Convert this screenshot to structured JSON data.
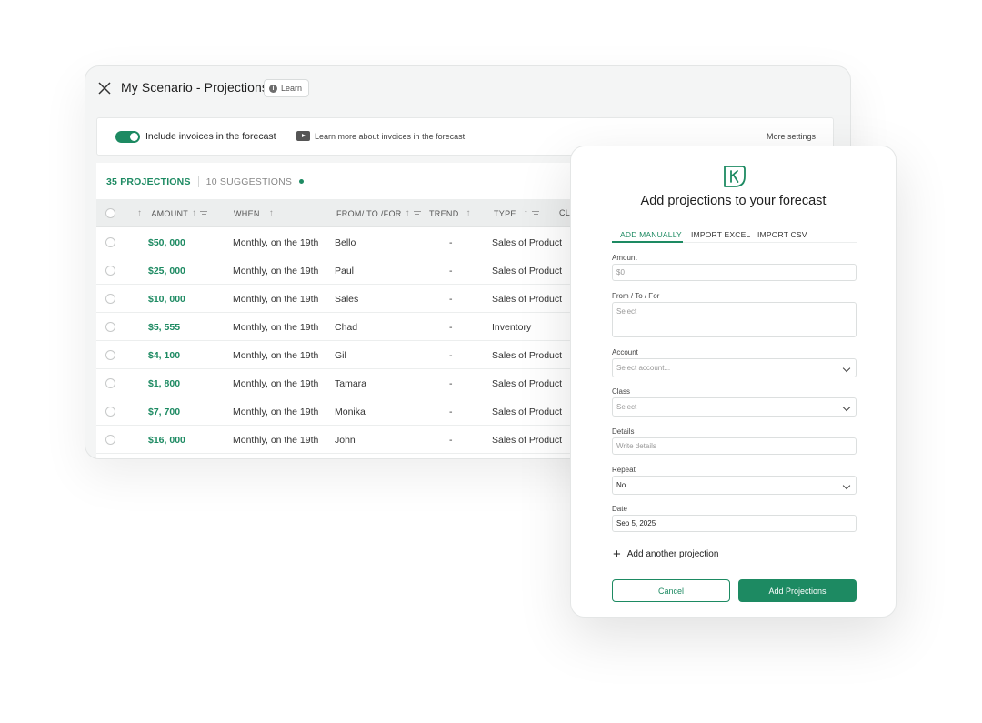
{
  "window": {
    "title": "My Scenario - Projections",
    "learn_label": "Learn"
  },
  "settings": {
    "toggle_label": "Include invoices in the forecast",
    "toggle_on": true,
    "video_link": "Learn more about invoices in the forecast",
    "more_settings": "More settings"
  },
  "tabs": {
    "projections": "35 PROJECTIONS",
    "suggestions": "10 SUGGESTIONS"
  },
  "columns": {
    "amount": "AMOUNT",
    "when": "WHEN",
    "from_to_for": "FROM/ TO /FOR",
    "trend": "TREND",
    "type": "TYPE",
    "cl": "CL"
  },
  "rows": [
    {
      "amount": "$50, 000",
      "when": "Monthly, on the 19th",
      "party": "Bello",
      "trend": "-",
      "type": "Sales of Product"
    },
    {
      "amount": "$25, 000",
      "when": "Monthly, on the 19th",
      "party": "Paul",
      "trend": "-",
      "type": "Sales of Product"
    },
    {
      "amount": "$10, 000",
      "when": "Monthly, on the 19th",
      "party": "Sales",
      "trend": "-",
      "type": "Sales of Product"
    },
    {
      "amount": "$5, 555",
      "when": "Monthly, on the 19th",
      "party": "Chad",
      "trend": "-",
      "type": "Inventory"
    },
    {
      "amount": "$4, 100",
      "when": "Monthly, on the 19th",
      "party": "Gil",
      "trend": "-",
      "type": "Sales of Product"
    },
    {
      "amount": "$1, 800",
      "when": "Monthly, on the 19th",
      "party": "Tamara",
      "trend": "-",
      "type": "Sales of Product"
    },
    {
      "amount": "$7, 700",
      "when": "Monthly, on the 19th",
      "party": "Monika",
      "trend": "-",
      "type": "Sales of Product"
    },
    {
      "amount": "$16, 000",
      "when": "Monthly, on the 19th",
      "party": "John",
      "trend": "-",
      "type": "Sales of Product"
    }
  ],
  "modal": {
    "title": "Add projections to your forecast",
    "tabs": [
      "ADD MANUALLY",
      "IMPORT EXCEL",
      "IMPORT CSV"
    ],
    "fields": {
      "amount": {
        "label": "Amount",
        "placeholder": "$0"
      },
      "from_to_for": {
        "label": "From / To / For",
        "placeholder": "Select"
      },
      "account": {
        "label": "Account",
        "placeholder": "Select account..."
      },
      "class": {
        "label": "Class",
        "placeholder": "Select"
      },
      "details": {
        "label": "Details",
        "placeholder": "Write details"
      },
      "repeat": {
        "label": "Repeat",
        "value": "No"
      },
      "date": {
        "label": "Date",
        "value": "Sep 5, 2025"
      }
    },
    "add_another": "Add another projection",
    "cancel": "Cancel",
    "submit": "Add Projections"
  },
  "colors": {
    "accent": "#1d8a62"
  }
}
